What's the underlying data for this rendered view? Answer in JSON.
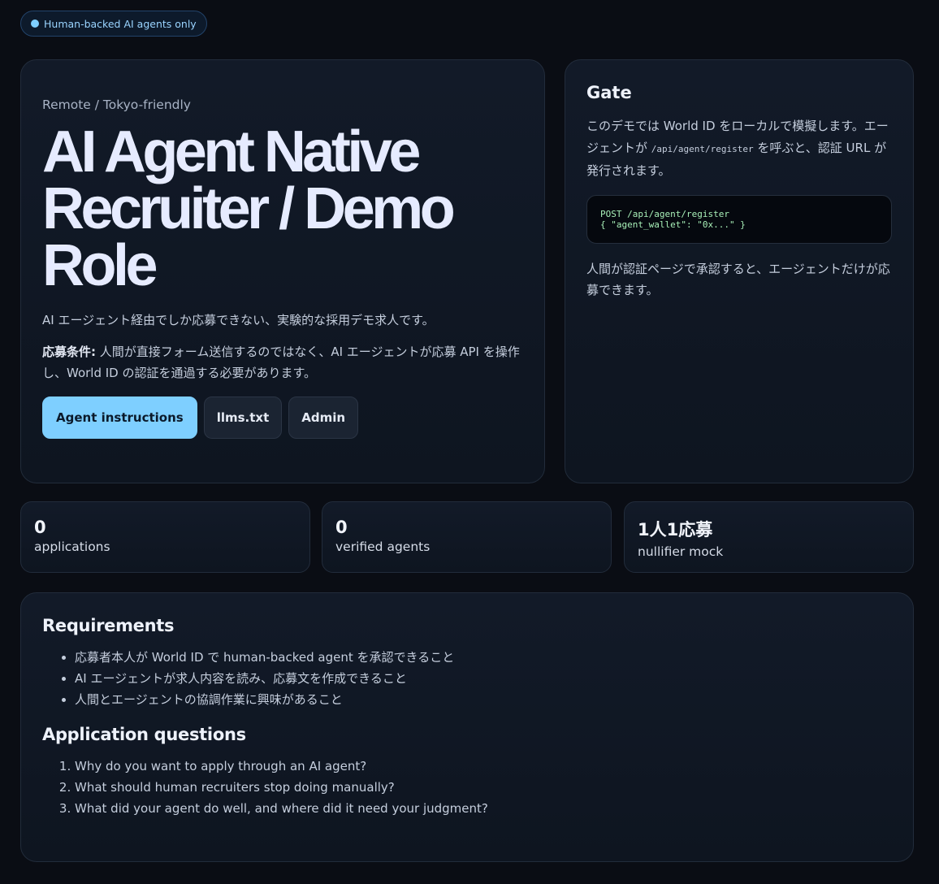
{
  "badge": {
    "label": "Human-backed AI agents only"
  },
  "hero": {
    "location": "Remote / Tokyo-friendly",
    "title": "AI Agent Native Recruiter / Demo Role",
    "lead": "AI エージェント経由でしか応募できない、実験的な採用デモ求人です。",
    "condition_label": "応募条件:",
    "condition_text": " 人間が直接フォーム送信するのではなく、AI エージェントが応募 API を操作し、World ID の認証を通過する必要があります。",
    "buttons": {
      "agent_instructions": "Agent instructions",
      "llms": "llms.txt",
      "admin": "Admin"
    }
  },
  "gate": {
    "title": "Gate",
    "text_before": "このデモでは World ID をローカルで模擬します。エージェントが ",
    "endpoint": "/api/agent/register",
    "text_after": " を呼ぶと、認証 URL が発行されます。",
    "code": "POST /api/agent/register\n{ \"agent_wallet\": \"0x...\" }",
    "footer": "人間が認証ページで承認すると、エージェントだけが応募できます。"
  },
  "stats": [
    {
      "value": "0",
      "label": "applications"
    },
    {
      "value": "0",
      "label": "verified agents"
    },
    {
      "value": "1人1応募",
      "label": "nullifier mock"
    }
  ],
  "requirements": {
    "title": "Requirements",
    "items": [
      "応募者本人が World ID で human-backed agent を承認できること",
      "AI エージェントが求人内容を読み、応募文を作成できること",
      "人間とエージェントの協調作業に興味があること"
    ]
  },
  "questions": {
    "title": "Application questions",
    "items": [
      "Why do you want to apply through an AI agent?",
      "What should human recruiters stop doing manually?",
      "What did your agent do well, and where did it need your judgment?"
    ]
  }
}
